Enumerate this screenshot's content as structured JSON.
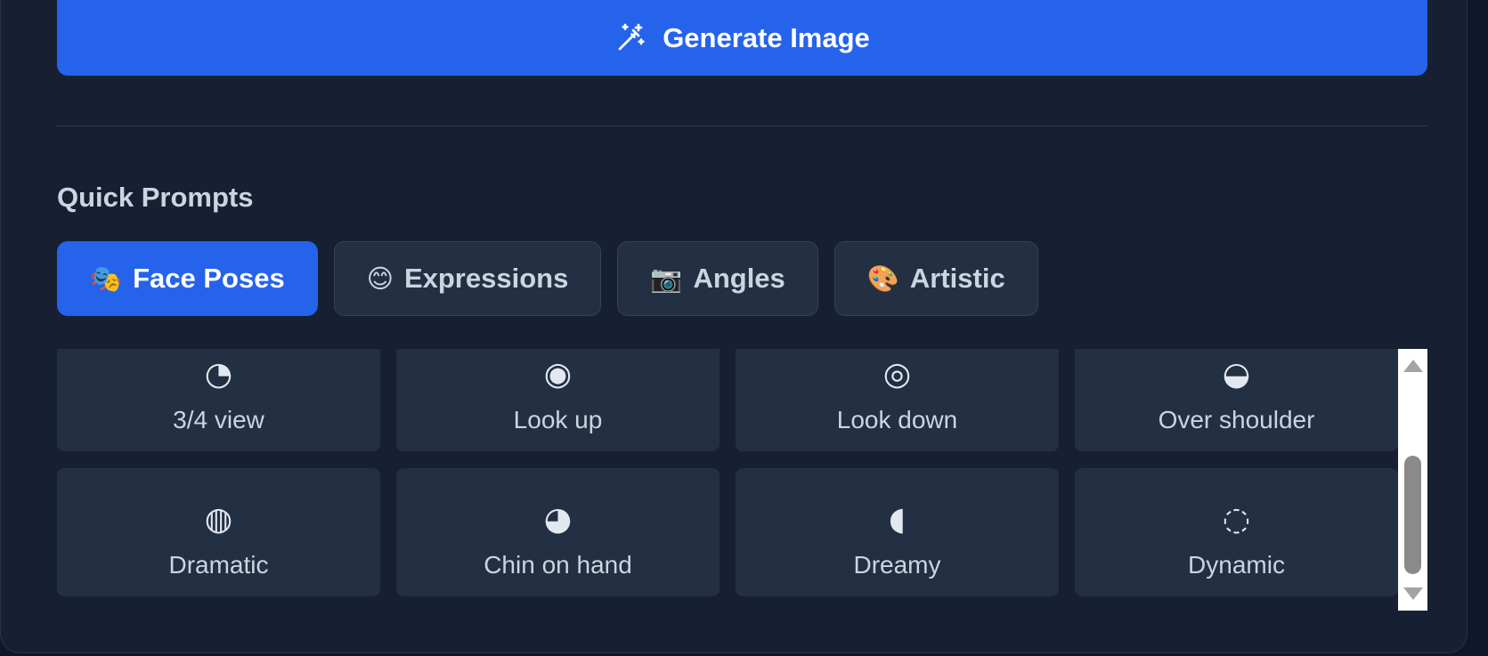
{
  "generate": {
    "label": "Generate Image",
    "icon": "magic-wand-icon"
  },
  "quick_prompts": {
    "title": "Quick Prompts",
    "tabs": [
      {
        "emoji": "🎭",
        "label": "Face Poses",
        "active": true
      },
      {
        "emoji": "😊",
        "label": "Expressions",
        "active": false
      },
      {
        "emoji": "📷",
        "label": "Angles",
        "active": false
      },
      {
        "emoji": "🎨",
        "label": "Artistic",
        "active": false
      }
    ],
    "prompts": [
      {
        "glyph": "◔",
        "label": "3/4 view"
      },
      {
        "glyph": "◉",
        "label": "Look up"
      },
      {
        "glyph": "◎",
        "label": "Look down"
      },
      {
        "glyph": "◒",
        "label": "Over shoulder"
      },
      {
        "glyph": "◍",
        "label": "Dramatic"
      },
      {
        "glyph": "◕",
        "label": "Chin on hand"
      },
      {
        "glyph": "◖",
        "label": "Dreamy"
      },
      {
        "glyph": "◌",
        "label": "Dynamic"
      }
    ]
  },
  "colors": {
    "accent": "#2563eb",
    "panel": "#172033",
    "card": "#232f42",
    "text": "#cbd5e1"
  }
}
